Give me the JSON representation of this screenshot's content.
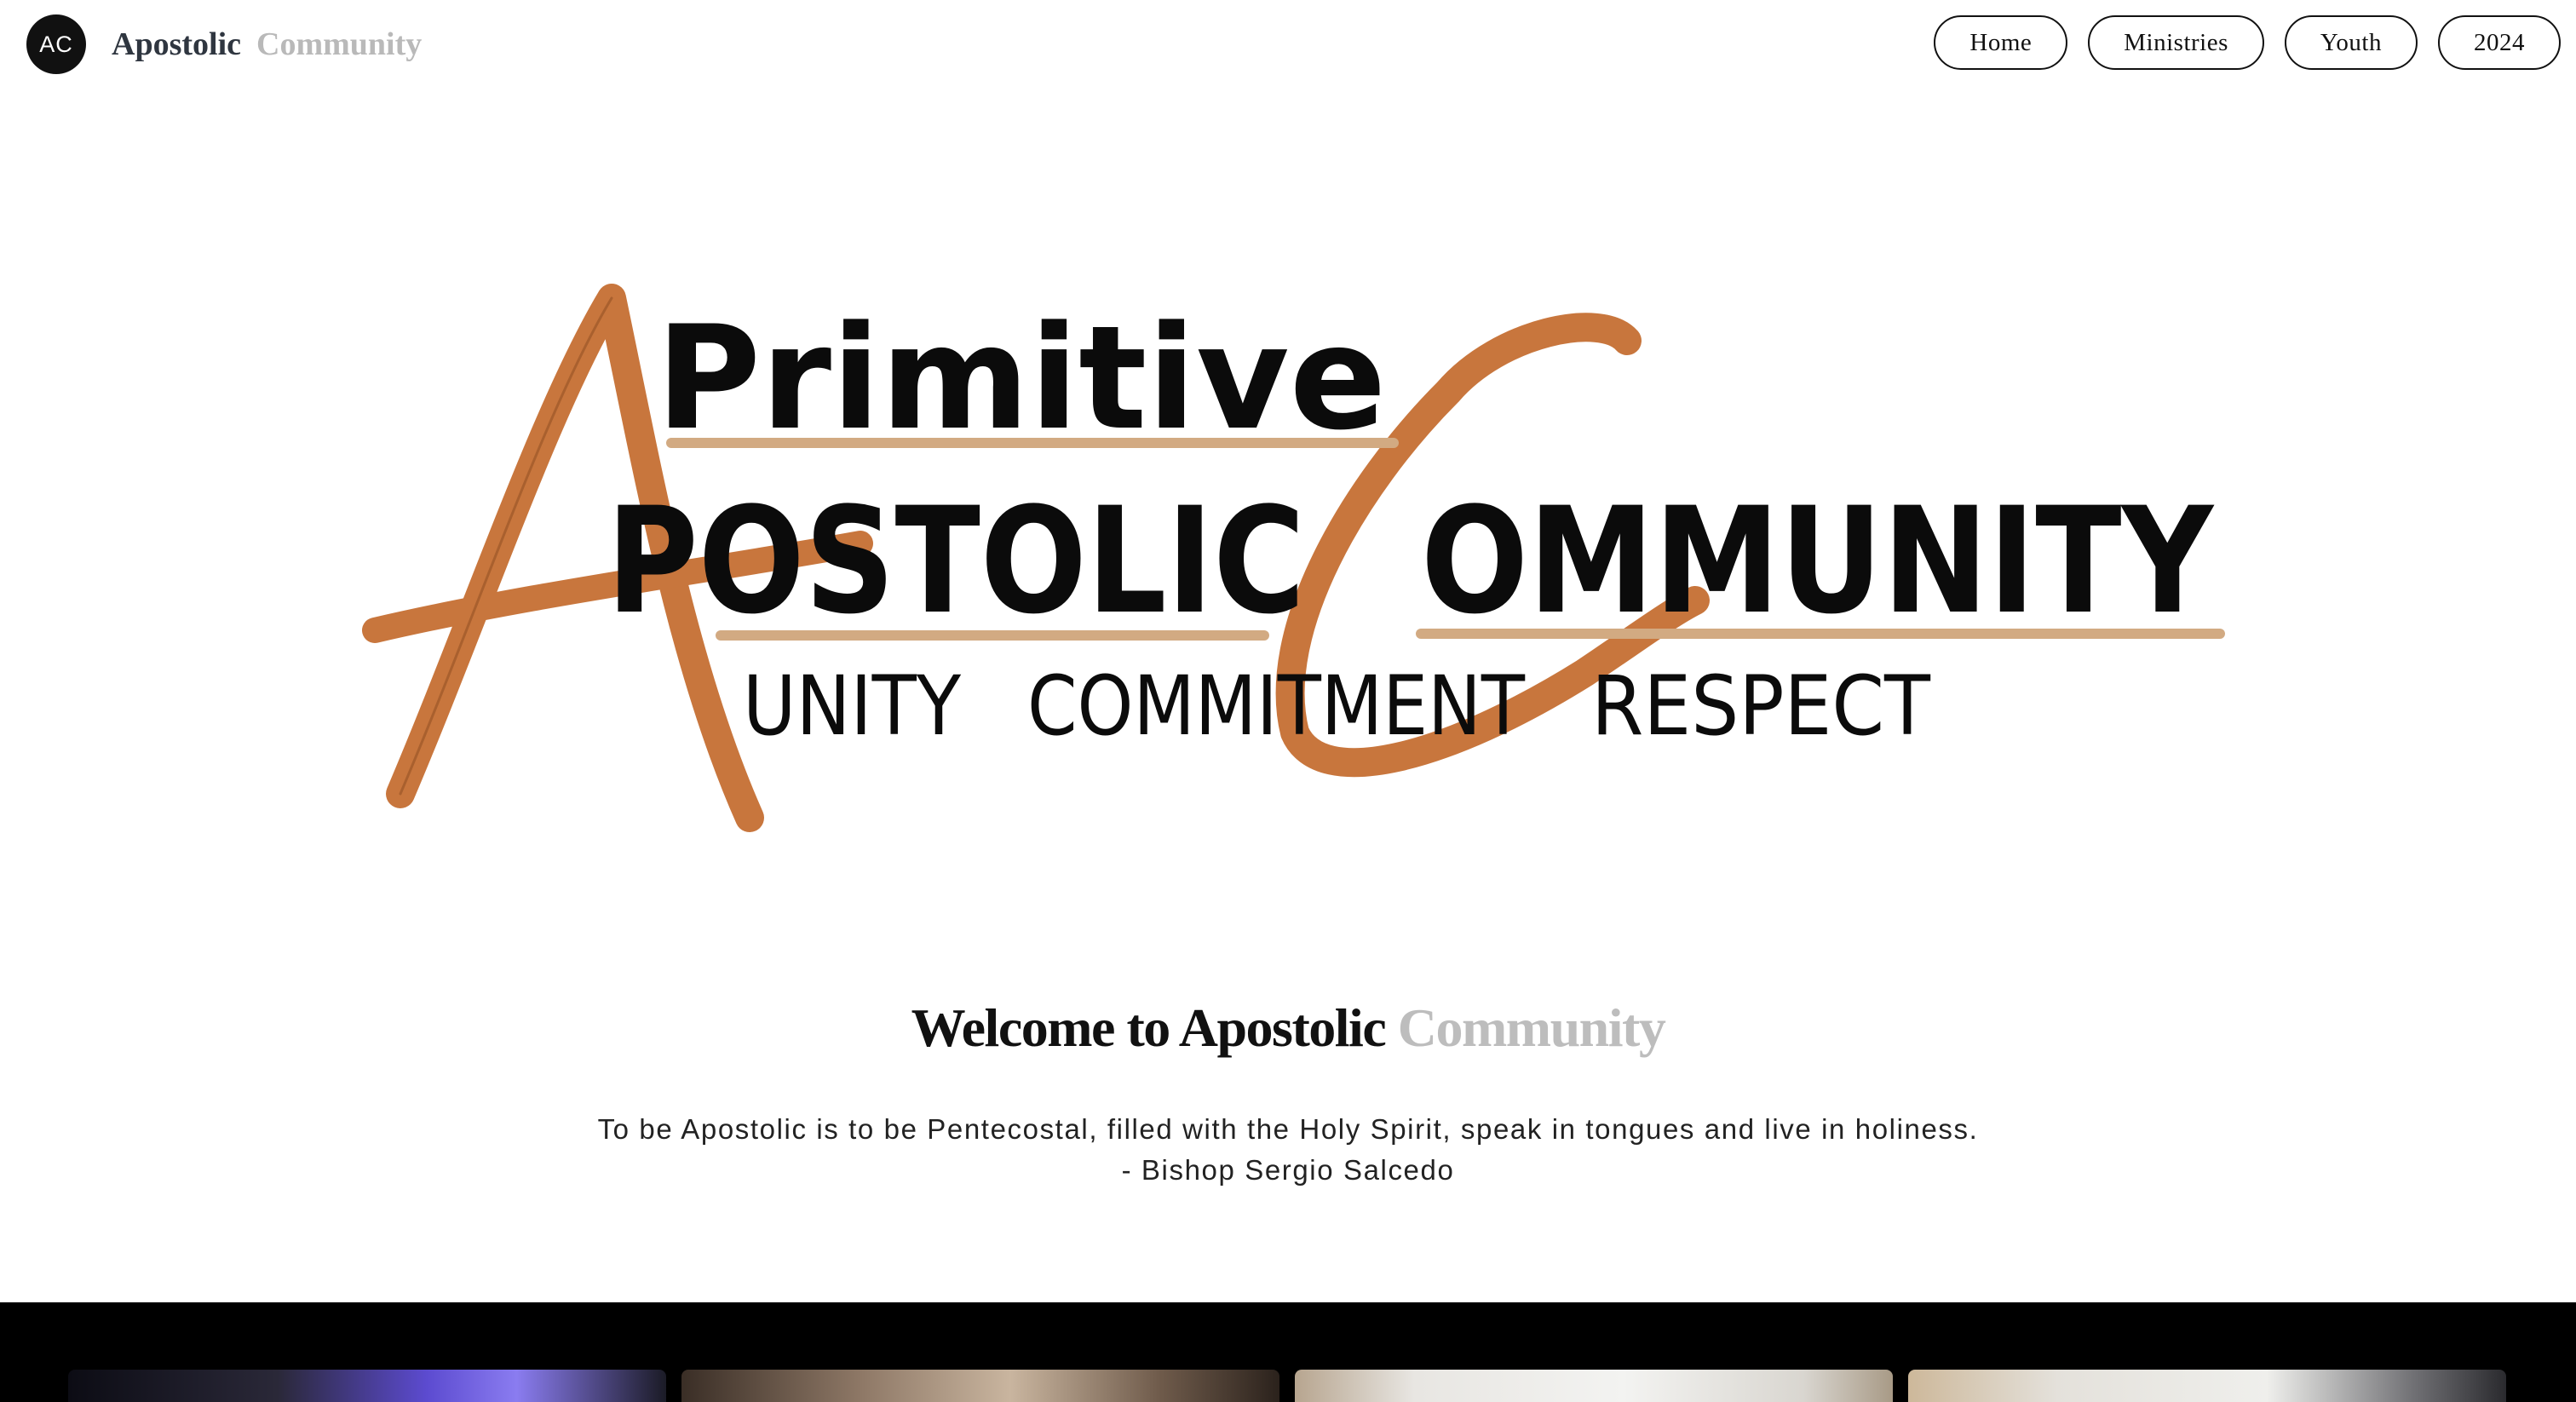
{
  "header": {
    "avatar_initials": "AC",
    "brand_part1": "Apostolic",
    "brand_part2": "Community",
    "nav": [
      "Home",
      "Ministries",
      "Youth",
      "2024"
    ]
  },
  "hero": {
    "logo_word_top": "Primitive",
    "logo_word_middle_left": "POSTOLIC",
    "logo_word_middle_right": "OMMUNITY",
    "logo_values": [
      "UNITY",
      "COMMITMENT",
      "RESPECT"
    ]
  },
  "welcome": {
    "title_part1": "Welcome to Apostolic",
    "title_part2": "Community",
    "quote_line1": "To be Apostolic is to be Pentecostal, filled with the Holy Spirit, speak in tongues and live in holiness.",
    "quote_line2": "- Bishop Sergio Salcedo"
  },
  "colors": {
    "accent_orange": "#c8763d",
    "underline_tan": "#d2aa82",
    "brand_dark": "#2f3640",
    "brand_muted": "#b9b9b9"
  }
}
